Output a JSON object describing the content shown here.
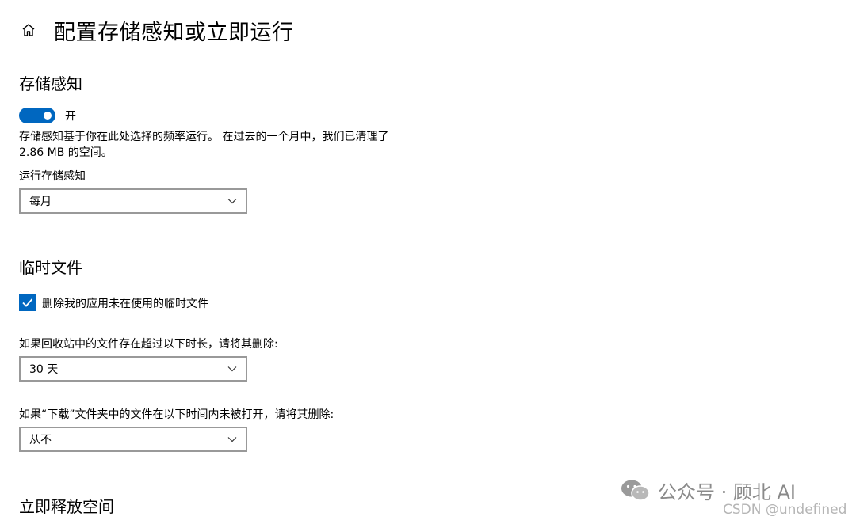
{
  "header": {
    "title": "配置存储感知或立即运行",
    "home_icon": "home-icon"
  },
  "storage_sense": {
    "heading": "存储感知",
    "toggle_state": "on",
    "toggle_label": "开",
    "description": "存储感知基于你在此处选择的频率运行。 在过去的一个月中，我们已清理了 2.86 MB 的空间。",
    "run_label": "运行存储感知",
    "run_value": "每月"
  },
  "temp_files": {
    "heading": "临时文件",
    "checkbox_checked": true,
    "checkbox_label": "删除我的应用未在使用的临时文件",
    "recycle_label": "如果回收站中的文件存在超过以下时长，请将其删除:",
    "recycle_value": "30 天",
    "downloads_label": "如果“下载”文件夹中的文件在以下时间内未被打开，请将其删除:",
    "downloads_value": "从不"
  },
  "free_space": {
    "heading": "立即释放空间"
  },
  "watermark": {
    "text": "公众号 · 顾北 AI",
    "csdn": "CSDN @undefined"
  },
  "colors": {
    "accent": "#0067c0",
    "dropdown_border": "#999999"
  }
}
